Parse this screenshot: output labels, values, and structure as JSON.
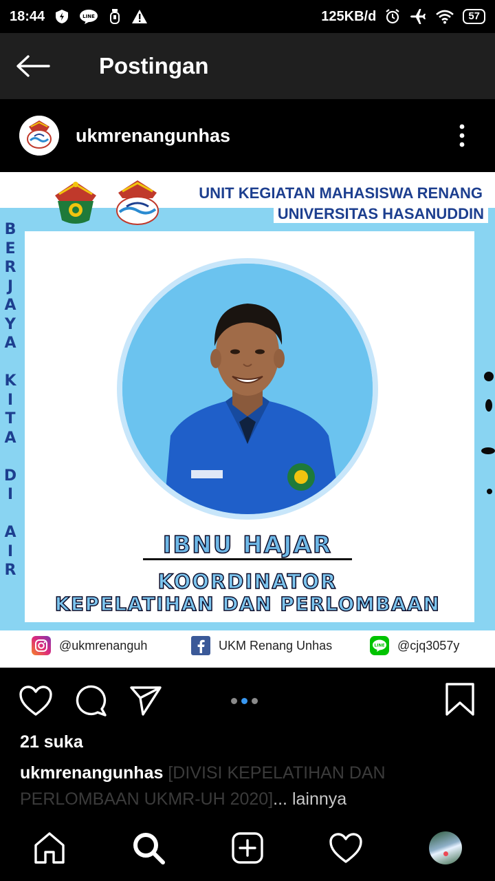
{
  "status_bar": {
    "time": "18:44",
    "network_speed": "125KB/d",
    "battery": "57",
    "icons": [
      "shield-icon",
      "line-app-icon",
      "usb-icon",
      "warning-icon",
      "alarm-icon",
      "airplane-icon",
      "wifi-icon",
      "battery-icon"
    ]
  },
  "toolbar": {
    "title": "Postingan"
  },
  "post": {
    "username": "ukmrenangunhas",
    "image": {
      "org_line1": "UNIT KEGIATAN MAHASISWA RENANG",
      "org_line2": "UNIVERSITAS HASANUDDIN",
      "vertical_motto": [
        "B",
        "E",
        "R",
        "J",
        "A",
        "Y",
        "A",
        "",
        "K",
        "I",
        "T",
        "A",
        "",
        "D",
        "I",
        "",
        "A",
        "I",
        "R"
      ],
      "person_name": "IBNU HAJAR",
      "role_line1": "KOORDINATOR",
      "role_line2": "KEPELATIHAN DAN PERLOMBAAN",
      "socials": {
        "instagram": "@ukmrenanguh",
        "facebook": "UKM Renang Unhas",
        "line": "@cjq3057y"
      },
      "colors": {
        "frame_blue": "#89d4f2",
        "title_blue": "#1d3f8f",
        "shirt_blue": "#1f5fc9"
      }
    },
    "carousel": {
      "count": 3,
      "active_index": 1
    },
    "likes": "21 suka",
    "caption": {
      "username": "ukmrenangunhas",
      "text": " [DIVISI KEPELATIHAN DAN PERLOMBAAN UKMR-UH 2020]",
      "more": "... lainnya"
    }
  },
  "bottom_nav": {
    "items": [
      "home-icon",
      "search-icon",
      "new-post-icon",
      "activity-heart-icon",
      "profile-avatar"
    ]
  }
}
